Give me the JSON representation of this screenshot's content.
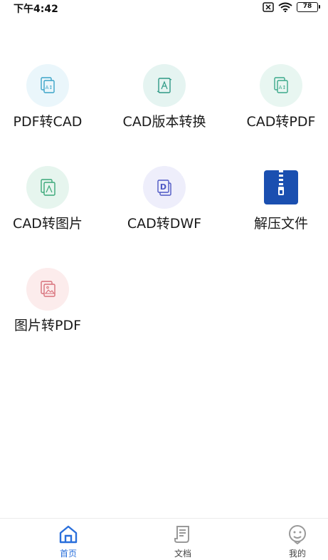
{
  "status_bar": {
    "time": "下午4:42",
    "battery": "78"
  },
  "tools": [
    {
      "label": "PDF转CAD",
      "icon": "pdf-to-cad-icon",
      "bg": "#eaf6fb",
      "fg": "#3aa4c8"
    },
    {
      "label": "CAD版本转换",
      "icon": "cad-version-convert-icon",
      "bg": "#e5f4f1",
      "fg": "#2f9a86"
    },
    {
      "label": "CAD转PDF",
      "icon": "cad-to-pdf-icon",
      "bg": "#e8f6f1",
      "fg": "#3aa88a"
    },
    {
      "label": "CAD转图片",
      "icon": "cad-to-image-icon",
      "bg": "#e6f5ee",
      "fg": "#3aa878"
    },
    {
      "label": "CAD转DWF",
      "icon": "cad-to-dwf-icon",
      "bg": "#eeeefb",
      "fg": "#4d57c4"
    },
    {
      "label": "解压文件",
      "icon": "zip-archive-icon",
      "bg": "#ffffff",
      "fg": "#1a4fb0"
    },
    {
      "label": "图片转PDF",
      "icon": "image-to-pdf-icon",
      "bg": "#fcecec",
      "fg": "#d8707a"
    }
  ],
  "tabbar": {
    "home": "首页",
    "documents": "文档",
    "mine": "我的",
    "active_color": "#2a6fdb",
    "inactive_color": "#999999"
  }
}
